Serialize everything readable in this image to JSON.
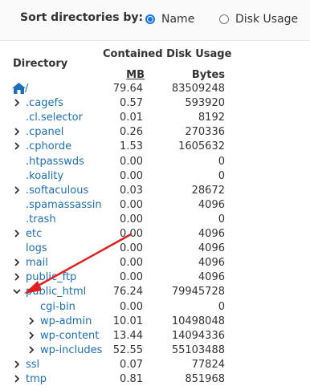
{
  "sort": {
    "label": "Sort directories by:",
    "options": [
      {
        "label": "Name",
        "checked": true
      },
      {
        "label": "Disk Usage",
        "checked": false
      }
    ]
  },
  "table": {
    "header_directory": "Directory",
    "header_usage": "Contained Disk Usage",
    "header_mb": "MB",
    "header_bytes": "Bytes"
  },
  "rows": [
    {
      "name": "/",
      "mb": "79.64",
      "bytes": "83509248",
      "icon": "home-icon"
    },
    {
      "name": ".cagefs",
      "mb": "0.57",
      "bytes": "593920",
      "toggle": "collapsed"
    },
    {
      "name": ".cl.selector",
      "mb": "0.01",
      "bytes": "8192"
    },
    {
      "name": ".cpanel",
      "mb": "0.26",
      "bytes": "270336",
      "toggle": "collapsed"
    },
    {
      "name": ".cphorde",
      "mb": "1.53",
      "bytes": "1605632",
      "toggle": "collapsed"
    },
    {
      "name": ".htpasswds",
      "mb": "0.00",
      "bytes": "0"
    },
    {
      "name": ".koality",
      "mb": "0.00",
      "bytes": "0"
    },
    {
      "name": ".softaculous",
      "mb": "0.03",
      "bytes": "28672",
      "toggle": "collapsed"
    },
    {
      "name": ".spamassassin",
      "mb": "0.00",
      "bytes": "4096"
    },
    {
      "name": ".trash",
      "mb": "0.00",
      "bytes": "0"
    },
    {
      "name": "etc",
      "mb": "0.00",
      "bytes": "4096",
      "toggle": "collapsed"
    },
    {
      "name": "logs",
      "mb": "0.00",
      "bytes": "4096"
    },
    {
      "name": "mail",
      "mb": "0.00",
      "bytes": "4096",
      "toggle": "collapsed"
    },
    {
      "name": "public_ftp",
      "mb": "0.00",
      "bytes": "4096",
      "toggle": "collapsed"
    },
    {
      "name": "public_html",
      "mb": "76.24",
      "bytes": "79945728",
      "toggle": "expanded"
    },
    {
      "name": "cgi-bin",
      "mb": "0.00",
      "bytes": "0",
      "indent": 1
    },
    {
      "name": "wp-admin",
      "mb": "10.01",
      "bytes": "10498048",
      "toggle": "collapsed",
      "indent": 1
    },
    {
      "name": "wp-content",
      "mb": "13.44",
      "bytes": "14094336",
      "toggle": "collapsed",
      "indent": 1
    },
    {
      "name": "wp-includes",
      "mb": "52.55",
      "bytes": "55103488",
      "toggle": "collapsed",
      "indent": 1
    },
    {
      "name": "ssl",
      "mb": "0.07",
      "bytes": "77824",
      "toggle": "collapsed"
    },
    {
      "name": "tmp",
      "mb": "0.81",
      "bytes": "851968",
      "toggle": "collapsed"
    }
  ],
  "colors": {
    "link": "#1d6fb8",
    "radio_accent": "#1a73e8",
    "annotation_arrow": "#e02020"
  }
}
